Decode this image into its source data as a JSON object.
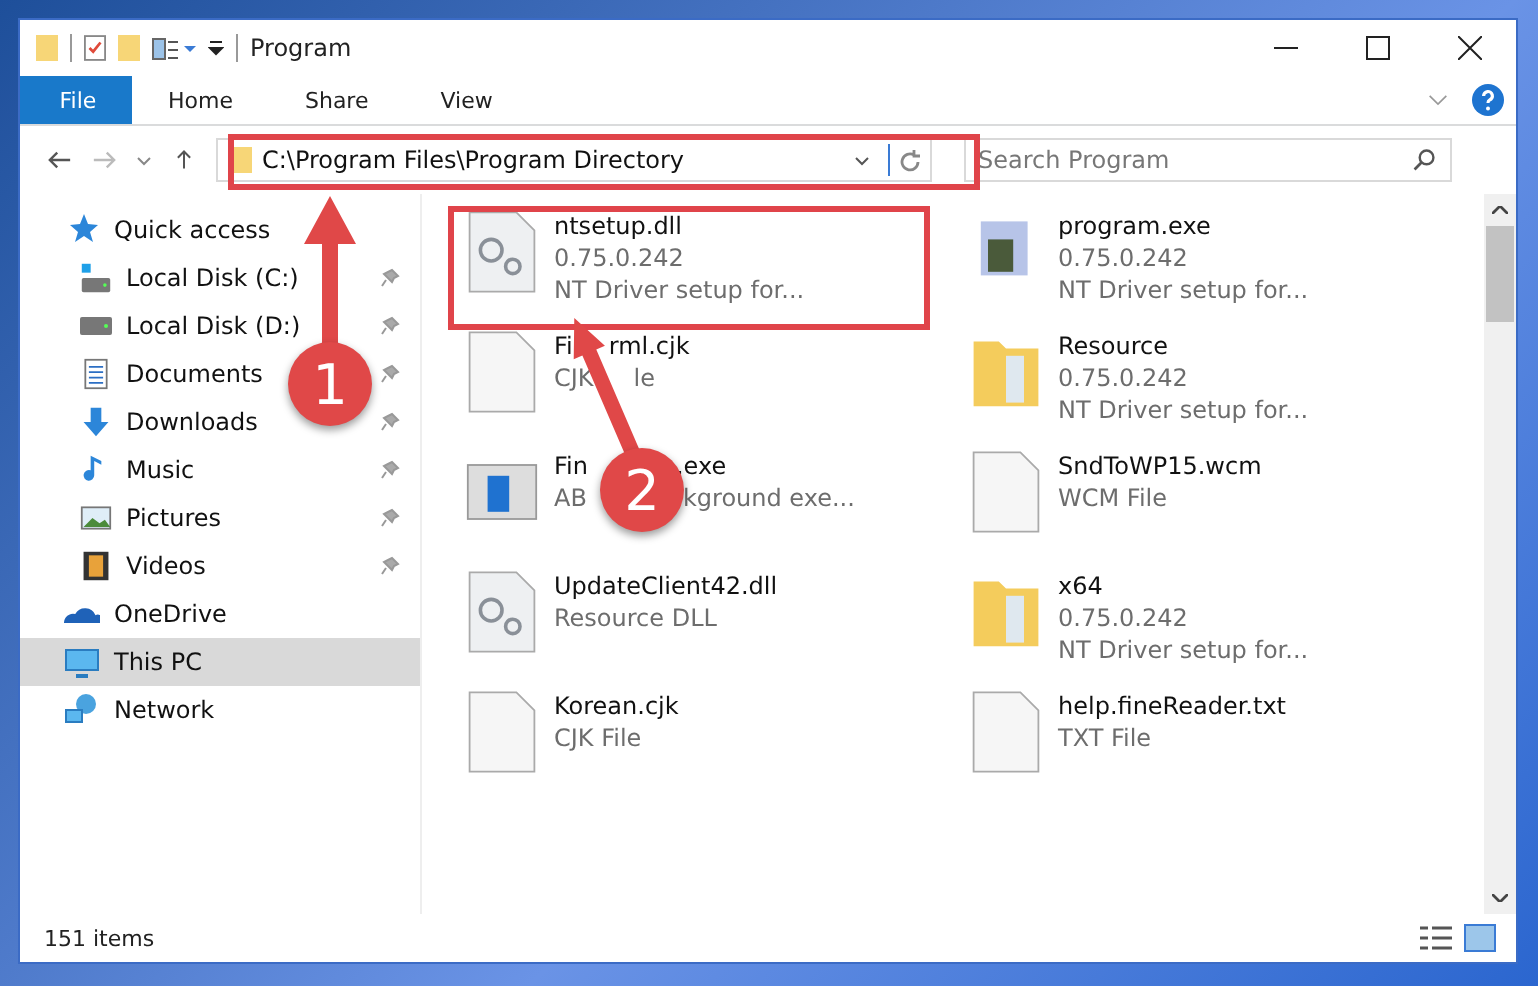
{
  "window": {
    "title": "Program"
  },
  "ribbon_tabs": [
    {
      "label": "File",
      "selected": true
    },
    {
      "label": "Home",
      "selected": false
    },
    {
      "label": "Share",
      "selected": false
    },
    {
      "label": "View",
      "selected": false
    }
  ],
  "address": {
    "value": "C:\\Program Files\\Program Directory"
  },
  "search": {
    "placeholder": "Search Program"
  },
  "sidebar": {
    "items": [
      {
        "label": "Quick access",
        "kind": "star",
        "selected": false,
        "children": [
          {
            "label": "Local Disk (C:)",
            "kind": "drive-win",
            "pinned": true,
            "selected": false
          },
          {
            "label": "Local Disk (D:)",
            "kind": "drive",
            "pinned": true,
            "selected": false
          },
          {
            "label": "Documents",
            "kind": "documents",
            "pinned": true,
            "selected": false
          },
          {
            "label": "Downloads",
            "kind": "downloads",
            "pinned": true,
            "selected": false
          },
          {
            "label": "Music",
            "kind": "music",
            "pinned": true,
            "selected": false
          },
          {
            "label": "Pictures",
            "kind": "pictures",
            "pinned": true,
            "selected": false
          },
          {
            "label": "Videos",
            "kind": "videos",
            "pinned": true,
            "selected": false
          }
        ]
      },
      {
        "label": "OneDrive",
        "kind": "cloud",
        "selected": false
      },
      {
        "label": "This PC",
        "kind": "pc",
        "selected": true
      },
      {
        "label": "Network",
        "kind": "network",
        "selected": false
      }
    ]
  },
  "files": [
    {
      "name": [
        "ntsetup.dll"
      ],
      "details": [
        [
          "0.75.0.242"
        ],
        [
          "NT Driver setup for..."
        ]
      ],
      "kind": "gears"
    },
    {
      "name": [
        "program.exe"
      ],
      "details": [
        [
          "0.75.0.242"
        ],
        [
          "NT Driver setup for..."
        ]
      ],
      "kind": "app"
    },
    {
      "name": [
        "Fi",
        "rml.cjk"
      ],
      "details": [
        [
          "CJK",
          "le"
        ]
      ],
      "kind": "doc"
    },
    {
      "name": [
        "Resource"
      ],
      "details": [
        [
          "0.75.0.242"
        ],
        [
          "NT Driver setup for..."
        ]
      ],
      "kind": "folder"
    },
    {
      "name": [
        "Fin",
        ".exe"
      ],
      "details": [
        [
          "AB",
          "kground exe..."
        ]
      ],
      "kind": "window"
    },
    {
      "name": [
        "SndToWP15.wcm"
      ],
      "details": [
        [
          "WCM File"
        ]
      ],
      "kind": "doc"
    },
    {
      "name": [
        "UpdateClient42.dll"
      ],
      "details": [
        [
          "Resource DLL"
        ]
      ],
      "kind": "gears"
    },
    {
      "name": [
        "x64"
      ],
      "details": [
        [
          "0.75.0.242"
        ],
        [
          "NT Driver setup for..."
        ]
      ],
      "kind": "folder"
    },
    {
      "name": [
        "Korean.cjk"
      ],
      "details": [
        [
          "CJK File"
        ]
      ],
      "kind": "doc"
    },
    {
      "name": [
        "help.fineReader.txt"
      ],
      "details": [
        [
          "TXT File"
        ]
      ],
      "kind": "doc"
    }
  ],
  "status_bar": {
    "item_count": "151 items"
  },
  "annotations": [
    {
      "number": "1"
    },
    {
      "number": "2"
    }
  ]
}
